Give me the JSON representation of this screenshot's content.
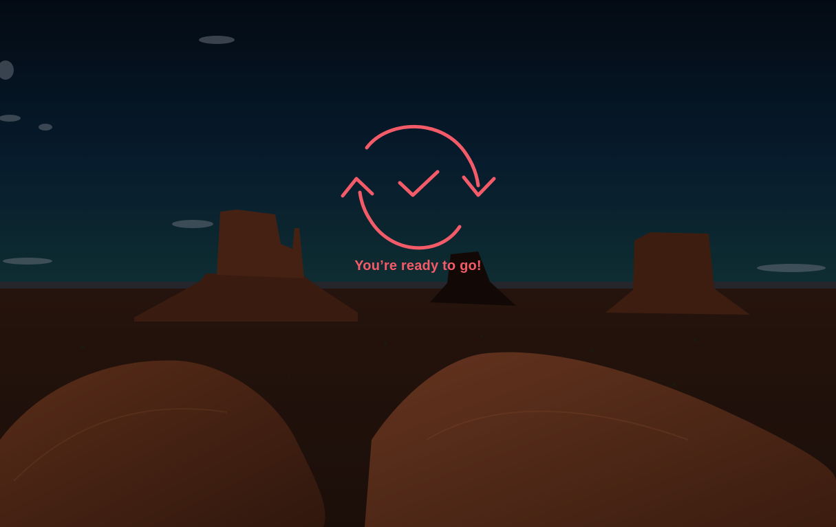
{
  "status": {
    "message": "You’re ready to go!",
    "icon": "sync-check-icon"
  },
  "colors": {
    "accent": "#f45b69",
    "sky_top": "#07101f",
    "sky_horizon": "#0e3a45",
    "ground": "#4a2516",
    "rock": "#7a3a22"
  }
}
